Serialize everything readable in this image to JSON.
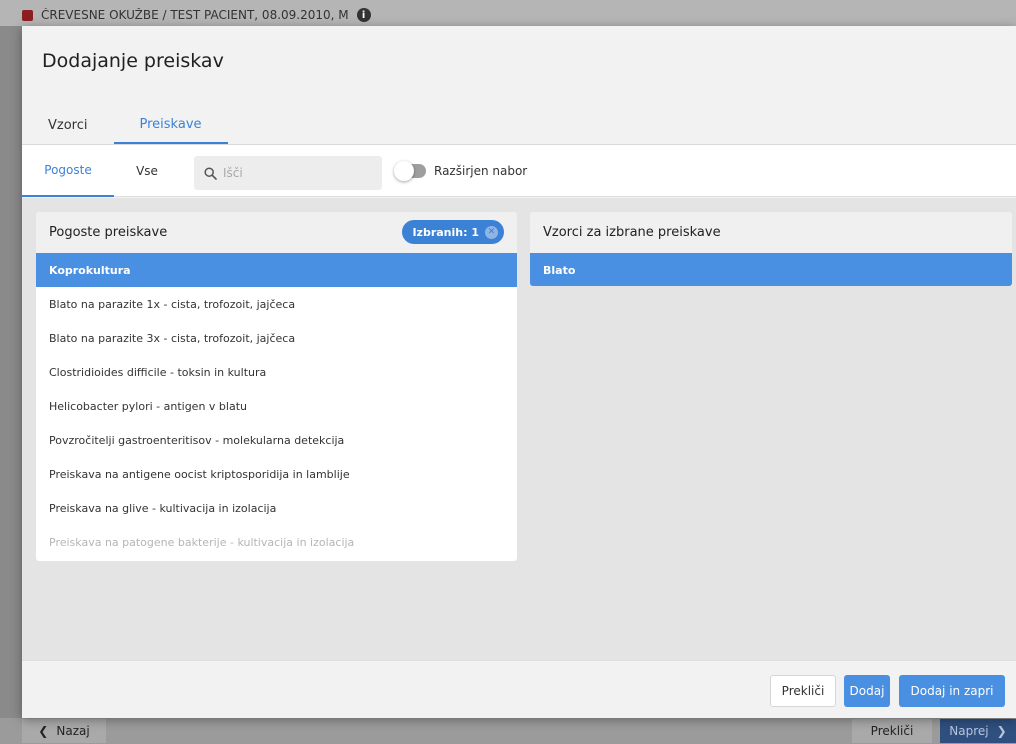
{
  "background": {
    "breadcrumb": "ČREVESNE OKUŽBE  /  TEST PACIENT, 08.09.2010, M",
    "back_label": "Nazaj",
    "cancel_label": "Prekliči",
    "next_label": "Naprej"
  },
  "modal": {
    "title": "Dodajanje preiskav",
    "tabs": [
      {
        "label": "Vzorci",
        "active": false
      },
      {
        "label": "Preiskave",
        "active": true
      }
    ],
    "subtabs": [
      {
        "label": "Pogoste",
        "active": true
      },
      {
        "label": "Vse",
        "active": false
      }
    ],
    "search": {
      "placeholder": "Išči",
      "value": ""
    },
    "toggle": {
      "label": "Razširjen nabor",
      "on": false
    },
    "left_panel": {
      "title": "Pogoste preiskave",
      "badge": "Izbranih: 1",
      "items": [
        {
          "label": "Koprokultura",
          "selected": true
        },
        {
          "label": "Blato na parazite 1x - cista, trofozoit, jajčeca",
          "selected": false
        },
        {
          "label": "Blato na parazite 3x - cista, trofozoit, jajčeca",
          "selected": false
        },
        {
          "label": "Clostridioides difficile - toksin in kultura",
          "selected": false
        },
        {
          "label": "Helicobacter pylori - antigen v blatu",
          "selected": false
        },
        {
          "label": "Povzročitelji gastroenteritisov - molekularna detekcija",
          "selected": false
        },
        {
          "label": "Preiskava na antigene oocist kriptosporidija in lamblije",
          "selected": false
        },
        {
          "label": "Preiskava na glive - kultivacija in izolacija",
          "selected": false
        },
        {
          "label": "Preiskava na patogene bakterije - kultivacija in izolacija",
          "selected": false
        }
      ]
    },
    "right_panel": {
      "title": "Vzorci za izbrane preiskave",
      "items": [
        {
          "label": "Blato",
          "selected": true
        }
      ]
    },
    "footer": {
      "cancel_label": "Prekliči",
      "add_label": "Dodaj",
      "add_close_label": "Dodaj in zapri"
    }
  },
  "colors": {
    "accent": "#4a90e2",
    "brand_marker": "#8b1e23"
  }
}
